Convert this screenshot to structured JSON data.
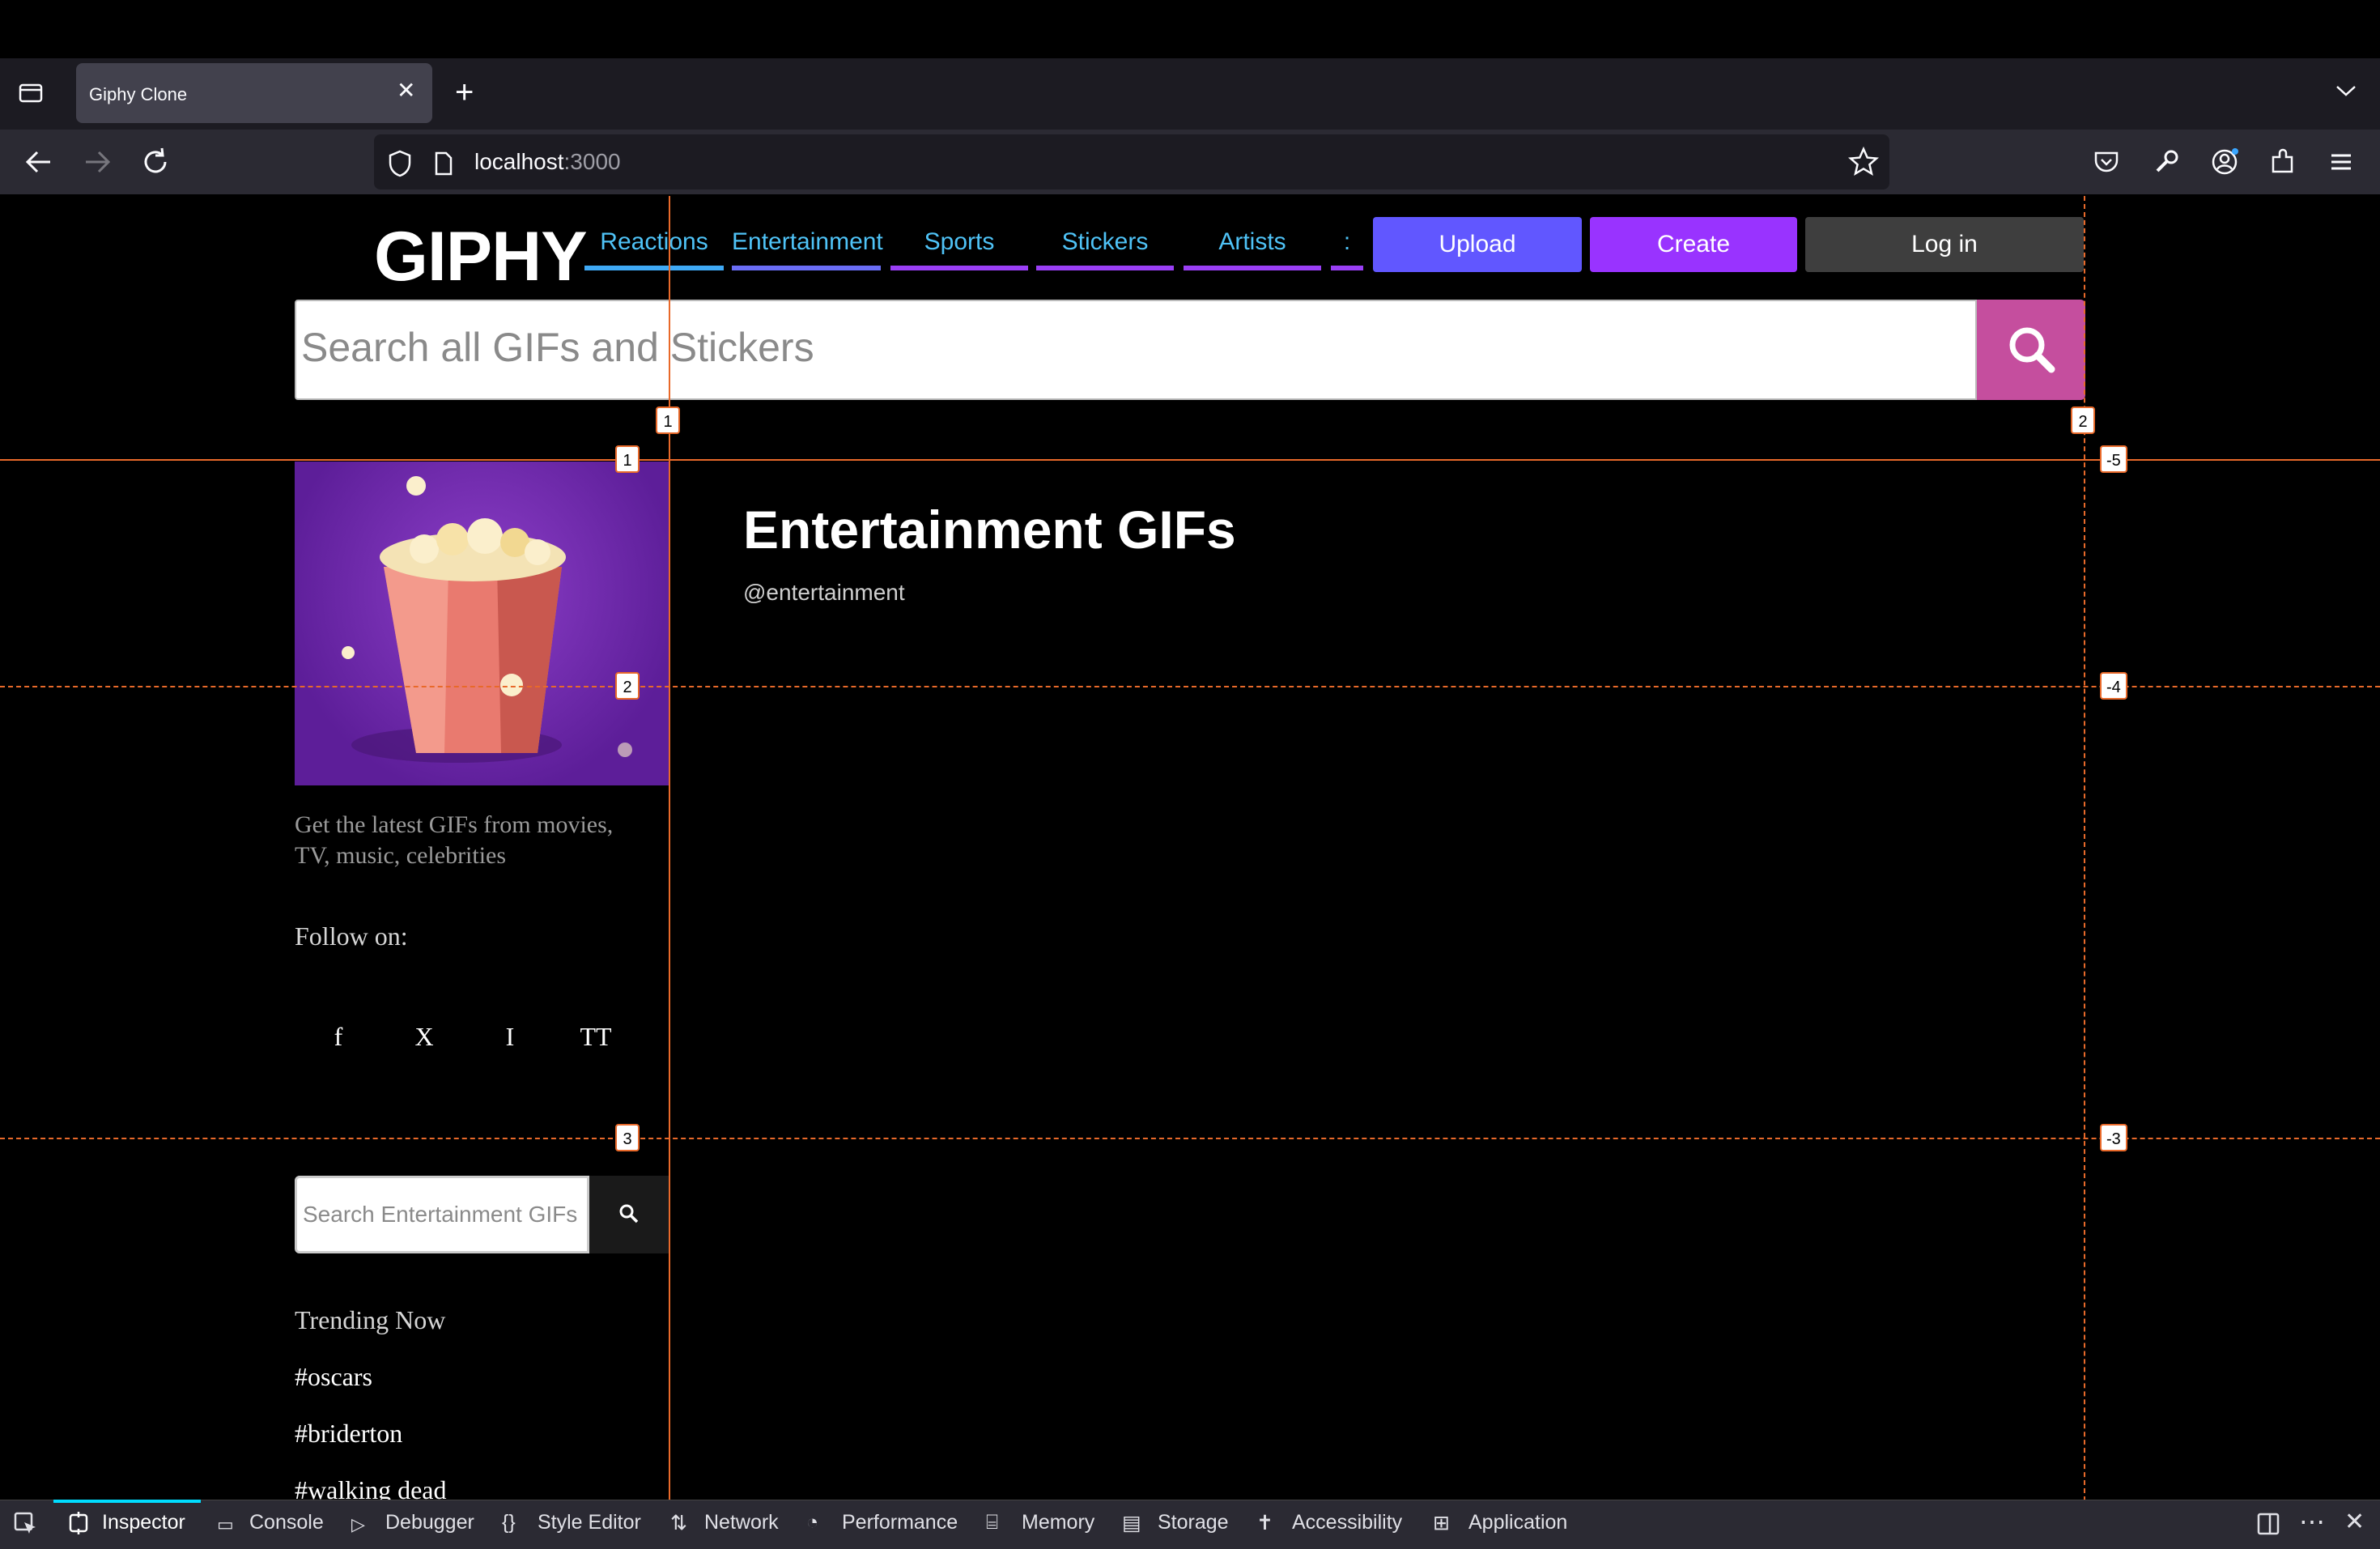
{
  "browser": {
    "tab_title": "Giphy Clone",
    "url_host": "localhost",
    "url_port": ":3000"
  },
  "header": {
    "logo": "GIPHY",
    "nav": [
      "Reactions",
      "Entertainment",
      "Sports",
      "Stickers",
      "Artists",
      ":"
    ],
    "upload_label": "Upload",
    "create_label": "Create",
    "login_label": "Log in",
    "search_placeholder": "Search all GIFs and Stickers"
  },
  "channel": {
    "title": "Entertainment GIFs",
    "handle": "@entertainment",
    "description": "Get the latest GIFs from movies, TV, music, celebrities",
    "follow_label": "Follow on:",
    "social": [
      "f",
      "X",
      "I",
      "TT"
    ],
    "search_placeholder": "Search Entertainment GIFs",
    "trending_title": "Trending Now",
    "trending": [
      "#oscars",
      "#briderton",
      "#walking dead"
    ]
  },
  "grid_overlay": {
    "column_labels": [
      "1",
      "2"
    ],
    "row_labels": [
      "1",
      "2",
      "3"
    ],
    "row_labels_negative": [
      "-5",
      "-4",
      "-3"
    ]
  },
  "devtools": {
    "tabs": [
      "Inspector",
      "Console",
      "Debugger",
      "Style Editor",
      "Network",
      "Performance",
      "Memory",
      "Storage",
      "Accessibility",
      "Application"
    ],
    "active_tab": "Inspector"
  },
  "colors": {
    "nav_link": "#4fc3f7",
    "upload": "#6157ff",
    "create": "#9933ff",
    "login": "#3e3e3e",
    "search_button": "#c54e9e",
    "grid_line": "#e8692a"
  }
}
